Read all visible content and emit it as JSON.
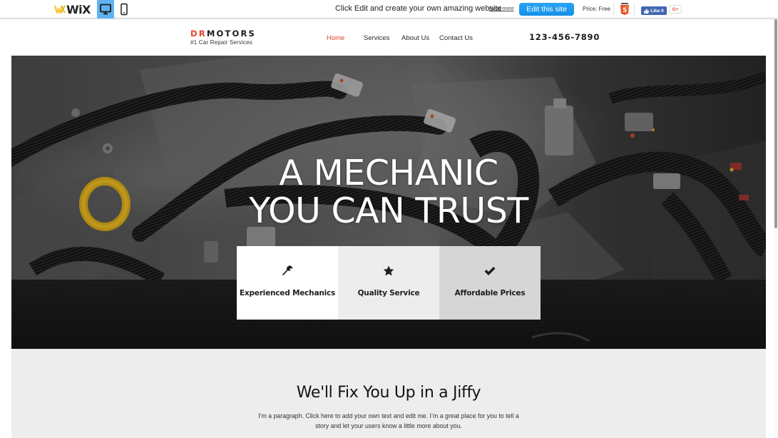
{
  "wix_bar": {
    "logo_text": "WiX",
    "device_buttons": [
      {
        "name": "desktop-view",
        "icon": "monitor-icon",
        "active": true
      },
      {
        "name": "mobile-view",
        "icon": "phone-icon",
        "active": false
      }
    ],
    "promo_text": "Click Edit and create your own amazing website",
    "read_more": "Read more",
    "edit_button": "Edit this site",
    "price": "Price: Free",
    "html5_badge": "html5-icon",
    "fb_like": "Like 0",
    "gplus": "G+"
  },
  "header": {
    "brand_prefix": "DR",
    "brand_suffix": "MOTORS",
    "tagline": "#1 Car Repair Services",
    "nav": [
      {
        "label": "Home",
        "active": true
      },
      {
        "label": "Services",
        "active": false
      },
      {
        "label": "About Us",
        "active": false
      },
      {
        "label": "Contact Us",
        "active": false
      }
    ],
    "phone": "123-456-7890",
    "accent_color": "#e1462a"
  },
  "hero": {
    "title_line1": "A MECHANIC",
    "title_line2": "YOU CAN TRUST",
    "features": [
      {
        "icon": "wrench-icon",
        "label": "Experienced Mechanics"
      },
      {
        "icon": "star-icon",
        "label": "Quality Service"
      },
      {
        "icon": "checkmark-icon",
        "label": "Affordable Prices"
      }
    ]
  },
  "about": {
    "heading": "We'll Fix You Up in a Jiffy",
    "paragraph": "I'm a paragraph. Click here to add your own text and edit me. I’m a great place for you to tell a story and let your users know a little more about you."
  }
}
